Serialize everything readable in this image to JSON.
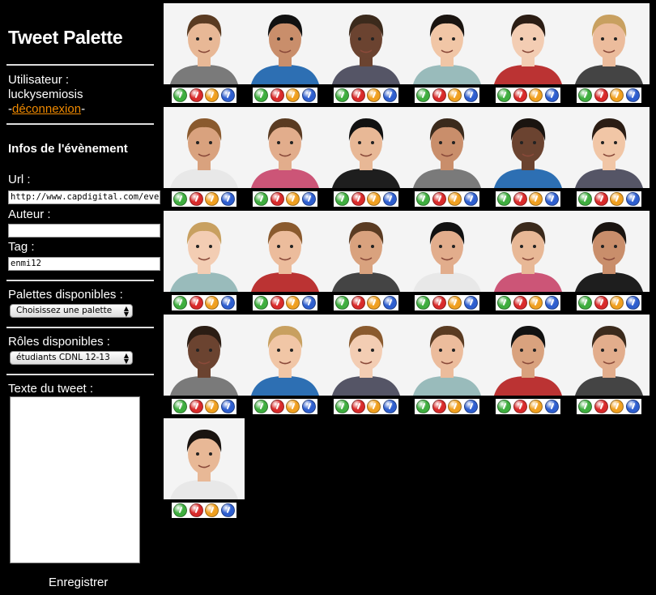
{
  "app": {
    "title": "Tweet Palette"
  },
  "user": {
    "label": "Utilisateur :",
    "name": "luckysemiosis",
    "logout_prefix": "-",
    "logout": "déconnexion",
    "logout_suffix": "-"
  },
  "event": {
    "heading": "Infos de l'évènement",
    "url_label": "Url :",
    "url_value": "http://www.capdigital.com/evene",
    "author_label": "Auteur :",
    "author_value": "",
    "tag_label": "Tag :",
    "tag_value": "enmi12"
  },
  "palettes": {
    "label": "Palettes disponibles :",
    "selected": "Choisissez une palette"
  },
  "roles": {
    "label": "Rôles disponibles :",
    "selected": "étudiants CDNL 12-13"
  },
  "tweet": {
    "label": "Texte du tweet :",
    "value": ""
  },
  "save_label": "Enregistrer",
  "colors": {
    "accent_link": "#f08a00",
    "button_green": "#3fae3f",
    "button_red": "#d92b2b",
    "button_orange": "#f0a020",
    "button_blue": "#2f5fcf"
  },
  "button_icons": [
    "green-round-icon",
    "red-round-icon",
    "orange-round-icon",
    "blue-round-icon"
  ],
  "people_count": 25
}
